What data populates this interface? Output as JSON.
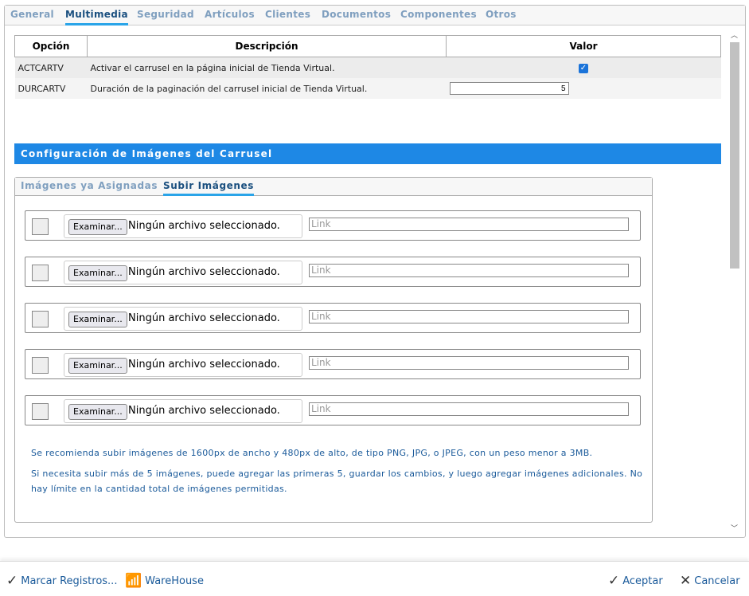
{
  "tabs": [
    "General",
    "Multimedia",
    "Seguridad",
    "Artículos",
    "Clientes",
    "Documentos",
    "Componentes",
    "Otros"
  ],
  "active_tab": "Multimedia",
  "table": {
    "headers": [
      "Opción",
      "Descripción",
      "Valor"
    ],
    "rows": [
      {
        "option": "ACTCARTV",
        "description": "Activar el carrusel en la página inicial de Tienda Virtual.",
        "checked": true
      },
      {
        "option": "DURCARTV",
        "description": "Duración de la paginación del carrusel inicial de Tienda Virtual.",
        "value": "5"
      }
    ]
  },
  "banner": "Configuración de Imágenes del Carrusel",
  "subtabs": [
    "Imágenes ya Asignadas",
    "Subir Imágenes"
  ],
  "upload": {
    "browse": "Examinar...",
    "status": "Ningún archivo seleccionado.",
    "link_placeholder": "Link"
  },
  "notes": [
    "Se recomienda subir imágenes de 1600px de ancho y 480px de alto, de tipo PNG, JPG, o JPEG, con un peso menor a 3MB.",
    "Si necesita subir más de 5 imágenes, puede agregar las primeras 5, guardar los cambios, y luego agregar imágenes adicionales. No hay límite en la cantidad total de imágenes permitidas."
  ],
  "footer": {
    "mark": "Marcar Registros...",
    "warehouse": "WareHouse",
    "accept": "Aceptar",
    "cancel": "Cancelar"
  }
}
